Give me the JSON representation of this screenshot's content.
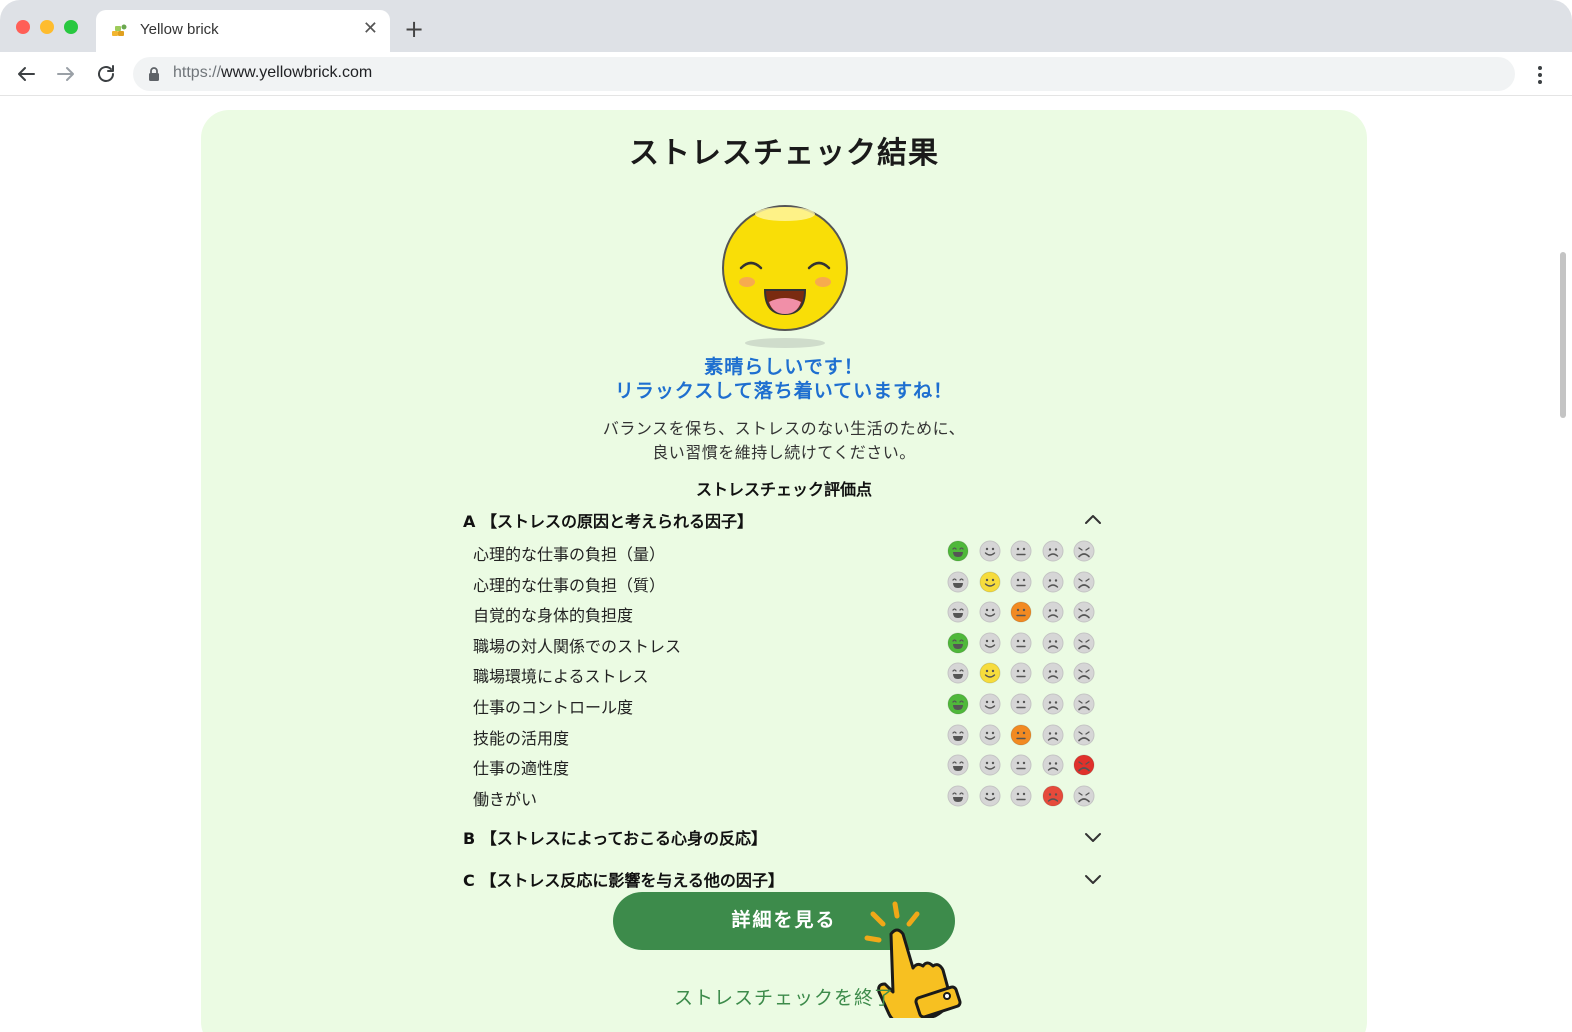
{
  "browser": {
    "tab_title": "Yellow brick",
    "url_scheme": "https://",
    "url_host": "www.yellowbrick.com"
  },
  "page": {
    "title": "ストレスチェック結果",
    "message_line1": "素晴らしいです！",
    "message_line2": "リラックスして落ち着いていますね！",
    "description_line1": "バランスを保ち、ストレスのない生活のために、",
    "description_line2": "良い習慣を維持し続けてください。",
    "evaluation_heading": "ストレスチェック評価点",
    "sections": [
      {
        "label": "A 【ストレスの原因と考えられる因子】",
        "expanded": true
      },
      {
        "label": "B 【ストレスによっておこる心身の反応】",
        "expanded": false
      },
      {
        "label": "C 【ストレス反応に影響を与える他の因子】",
        "expanded": false
      }
    ],
    "rows": [
      {
        "label": "心理的な仕事の負担（量）",
        "level": 1
      },
      {
        "label": "心理的な仕事の負担（質）",
        "level": 2
      },
      {
        "label": "自覚的な身体的負担度",
        "level": 3
      },
      {
        "label": "職場の対人関係でのストレス",
        "level": 1
      },
      {
        "label": "職場環境によるストレス",
        "level": 2
      },
      {
        "label": "仕事のコントロール度",
        "level": 1
      },
      {
        "label": "技能の活用度",
        "level": 3
      },
      {
        "label": "仕事の適性度",
        "level": 5
      },
      {
        "label": "働きがい",
        "level": 4
      }
    ],
    "level_colors": [
      "#4fb83a",
      "#f6dc3c",
      "#f28a22",
      "#e64a3b",
      "#e0312b"
    ],
    "inactive_color": "#d6d6d6",
    "detail_button": "詳細を見る",
    "end_link": "ストレスチェックを終了"
  }
}
